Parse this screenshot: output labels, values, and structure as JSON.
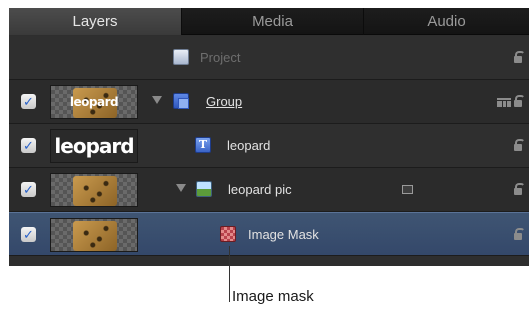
{
  "tabs": [
    {
      "label": "Layers",
      "active": true
    },
    {
      "label": "Media",
      "active": false
    },
    {
      "label": "Audio",
      "active": false
    }
  ],
  "layers": [
    {
      "name": "Project",
      "icon": "project-icon",
      "enabled": null
    },
    {
      "name": "Group",
      "icon": "group-icon",
      "enabled": true,
      "thumbnail_text": "leopard",
      "expanded": true
    },
    {
      "name": "leopard",
      "icon": "text-layer-icon",
      "enabled": true,
      "thumbnail_text": "leopard"
    },
    {
      "name": "leopard pic",
      "icon": "image-layer-icon",
      "enabled": true,
      "expanded": true
    },
    {
      "name": "Image Mask",
      "icon": "image-mask-icon",
      "enabled": true,
      "selected": true
    }
  ],
  "callout": {
    "label": "Image mask"
  },
  "colors": {
    "panel_bg": "#2e2e2e",
    "selection": "#3a4f6e",
    "check_mark": "#2a62c9"
  }
}
